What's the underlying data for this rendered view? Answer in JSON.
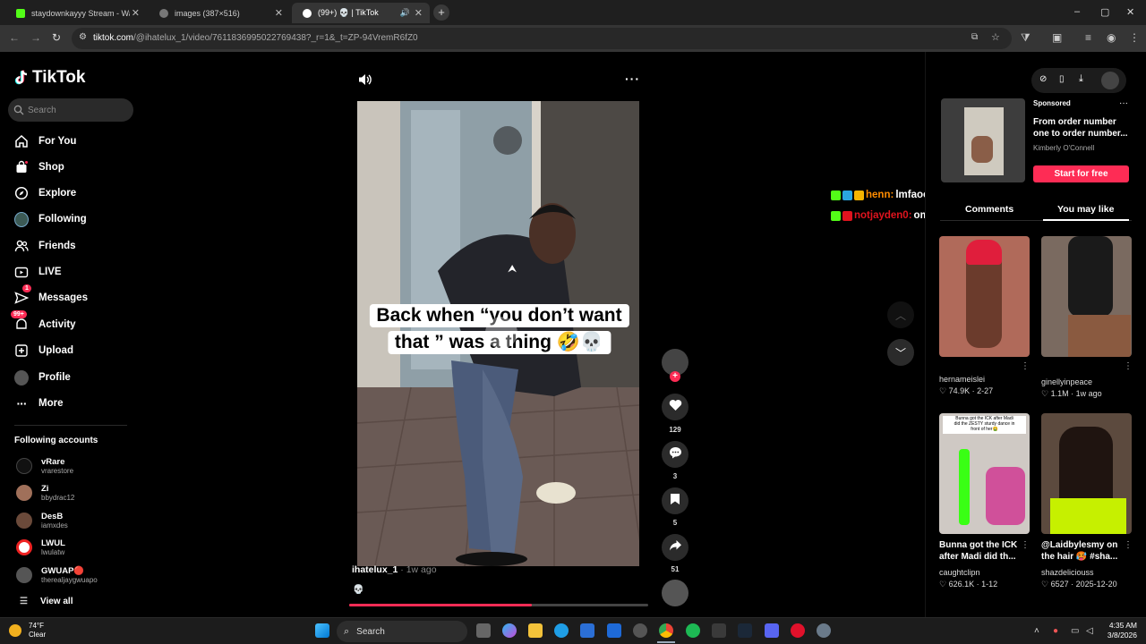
{
  "browser": {
    "tabs": [
      {
        "label": "staydownkayyy Stream - Watch",
        "favicon_color": "#53fc18",
        "active": false
      },
      {
        "label": "images (387×516)",
        "favicon_color": "#888888",
        "active": false
      },
      {
        "label": "(99+) 💀 | TikTok",
        "favicon_color": "#ffffff",
        "active": true
      }
    ],
    "new_tab": "+",
    "url_host": "tiktok.com",
    "url_path": "/@ihatelux_1/video/7611836995022769438?_r=1&_t=ZP-94VremR6fZ0",
    "window_controls": [
      "–",
      "▢",
      "✕"
    ]
  },
  "sidebar": {
    "logo_text": "TikTok",
    "search_placeholder": "Search",
    "nav": [
      {
        "label": "For You",
        "icon": "home-icon"
      },
      {
        "label": "Shop",
        "icon": "shop-bag-icon"
      },
      {
        "label": "Explore",
        "icon": "compass-icon"
      },
      {
        "label": "Following",
        "icon": "following-avatar-icon"
      },
      {
        "label": "Friends",
        "icon": "friends-icon"
      },
      {
        "label": "LIVE",
        "icon": "live-icon"
      },
      {
        "label": "Messages",
        "icon": "messages-icon",
        "badge": "1"
      },
      {
        "label": "Activity",
        "icon": "activity-icon",
        "badge": "99+"
      },
      {
        "label": "Upload",
        "icon": "upload-icon"
      },
      {
        "label": "Profile",
        "icon": "profile-avatar-icon"
      },
      {
        "label": "More",
        "icon": "more-dots-icon"
      }
    ],
    "following_title": "Following accounts",
    "accounts": [
      {
        "name": "vRare",
        "handle": "vrarestore",
        "color": "#111111"
      },
      {
        "name": "Zi",
        "handle": "bbydrac12",
        "color": "#a0705a"
      },
      {
        "name": "DesB",
        "handle": "iamxdes",
        "color": "#6b4a3a"
      },
      {
        "name": "LWUL",
        "handle": "lwulatw",
        "color": "#ffffff"
      },
      {
        "name": "GWUAP🔴",
        "handle": "therealjaygwuapo",
        "color": "#555555"
      }
    ],
    "view_all": "View all"
  },
  "video": {
    "caption_line1": "Back when “you don’t want",
    "caption_line2": "that ” was a thing 🤣💀",
    "author": "ihatelux_1",
    "time_ago": " · 1w ago",
    "description": "💀",
    "progress": 0.61,
    "actions": [
      {
        "icon": "heart-icon",
        "count": "129"
      },
      {
        "icon": "comment-icon",
        "count": "3"
      },
      {
        "icon": "bookmark-icon",
        "count": "5"
      },
      {
        "icon": "share-icon",
        "count": "51"
      }
    ]
  },
  "chat": [
    {
      "user": "henn:",
      "message": "lmfaooo",
      "user_color": "#ff8c00"
    },
    {
      "user": "notjayden0:",
      "message": "omg",
      "user_color": "#e0141e"
    }
  ],
  "right_panel": {
    "ad": {
      "sponsored": "Sponsored",
      "title": "From order number one to order number...",
      "by": "Kimberly O'Connell",
      "cta": "Start for free"
    },
    "tabs": [
      "Comments",
      "You may like"
    ],
    "cards": [
      {
        "caption": "",
        "user": "hernameislei",
        "stats": "♡ 74.9K · 2-27",
        "bg": "#b06a5a"
      },
      {
        "caption": "",
        "user": "ginellyinpeace",
        "stats": "♡ 1.1M · 1w ago",
        "bg": "#7a6a60"
      },
      {
        "caption": "Bunna got the ICK after Madi did th...",
        "user": "caughtclipn",
        "stats": "♡ 626.1K · 1-12",
        "bg": "#cfc9c4"
      },
      {
        "caption": "@Laidbylesmy on the hair 🥵 #sha...",
        "user": "shazdeliciouss",
        "stats": "♡ 6527 · 2025-12-20",
        "bg": "#5c4a3e"
      }
    ]
  },
  "taskbar": {
    "temp": "74°F",
    "condition": "Clear",
    "search": "Search",
    "time": "4:35 AM",
    "date": "3/8/2026"
  }
}
